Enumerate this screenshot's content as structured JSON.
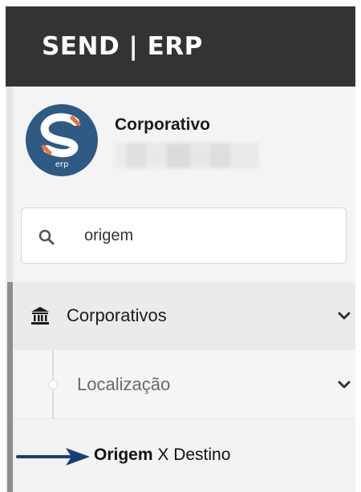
{
  "header": {
    "brand": "SEND | ERP"
  },
  "profile": {
    "logo_letter": "S",
    "logo_text": "erp",
    "company_name": "Corporativo"
  },
  "search": {
    "value": "origem",
    "icon": "search-icon"
  },
  "menu": {
    "group": {
      "label": "Corporativos",
      "icon": "bank-icon"
    },
    "subgroup": {
      "label": "Localização"
    },
    "item": {
      "label_match": "Origem",
      "label_rest": " X Destino"
    }
  },
  "colors": {
    "header_bg": "#333333",
    "sidebar_bg": "#f4f4f4",
    "logo_blue": "#2e5a84",
    "accent_orange": "#e8703a",
    "arrow_blue": "#163f78"
  }
}
